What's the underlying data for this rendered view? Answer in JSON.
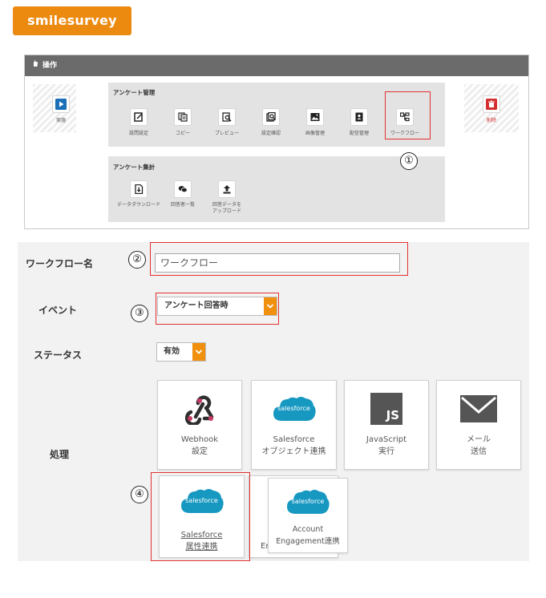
{
  "logo": {
    "text": "smilesurvey"
  },
  "ops": {
    "header": "操作",
    "run": {
      "label": "実施"
    },
    "delete": {
      "label": "削除"
    },
    "survey_mgmt": {
      "title": "アンケート管理",
      "items": [
        {
          "label": "設問設定",
          "icon": "edit-icon"
        },
        {
          "label": "コピー",
          "icon": "copy-icon"
        },
        {
          "label": "プレビュー",
          "icon": "preview-icon"
        },
        {
          "label": "設定確認",
          "icon": "settings-check-icon"
        },
        {
          "label": "画像管理",
          "icon": "image-icon"
        },
        {
          "label": "配信管理",
          "icon": "contact-book-icon"
        },
        {
          "label": "ワークフロー",
          "icon": "workflow-icon"
        }
      ]
    },
    "survey_stats": {
      "title": "アンケート集計",
      "items": [
        {
          "label": "データダウンロード",
          "icon": "download-file-icon"
        },
        {
          "label": "回答者一覧",
          "icon": "chat-icon"
        },
        {
          "label": "回答データをアップロード",
          "icon": "upload-icon"
        }
      ]
    }
  },
  "markers": [
    "①",
    "②",
    "③",
    "④"
  ],
  "form": {
    "workflow_name": {
      "label": "ワークフロー名",
      "value": "ワークフロー"
    },
    "event": {
      "label": "イベント",
      "value": "アンケート回答時"
    },
    "status": {
      "label": "ステータス",
      "value": "有効"
    },
    "process": {
      "label": "処理",
      "cards": [
        {
          "line1": "Webhook",
          "line2": "設定",
          "icon": "webhook-icon"
        },
        {
          "line1": "Salesforce",
          "line2": "オブジェクト連携",
          "icon": "salesforce-icon",
          "logo_text": "salesforce"
        },
        {
          "line1": "JavaScript",
          "line2": "実行",
          "icon": "javascript-icon",
          "logo_text": "JS"
        },
        {
          "line1": "メール",
          "line2": "送信",
          "icon": "mail-icon"
        },
        {
          "line1": "Salesforce",
          "line2": "属性連携",
          "icon": "salesforce-icon",
          "logo_text": "salesforce"
        },
        {
          "line1": "Account",
          "line2": "Engagement連携",
          "icon": "salesforce-icon",
          "logo_text": "salesforce",
          "hidden_prefix": "Er"
        }
      ]
    }
  },
  "colors": {
    "brand_orange": "#ec8a10",
    "salesforce_blue": "#1798c1",
    "highlight_red": "#e0312f",
    "header_gray": "#6b6b6b"
  }
}
